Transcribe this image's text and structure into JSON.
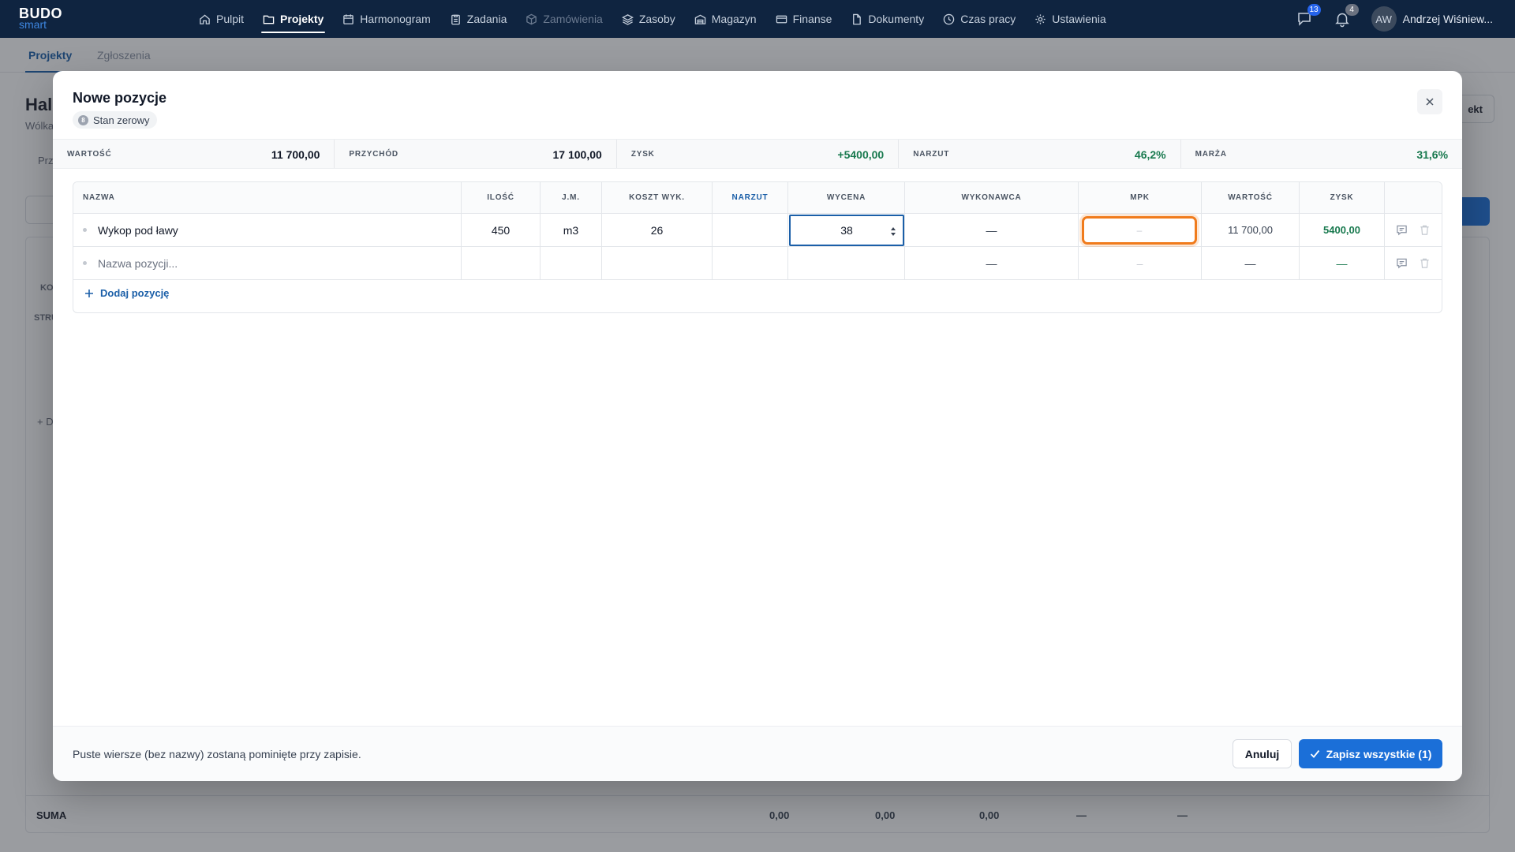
{
  "app": {
    "logo_top": "BUDO",
    "logo_bottom": "smart"
  },
  "nav": {
    "items": [
      {
        "label": "Pulpit",
        "icon": "home-icon"
      },
      {
        "label": "Projekty",
        "icon": "folder-icon"
      },
      {
        "label": "Harmonogram",
        "icon": "calendar-icon"
      },
      {
        "label": "Zadania",
        "icon": "clipboard-icon"
      },
      {
        "label": "Zamówienia",
        "icon": "box-icon"
      },
      {
        "label": "Zasoby",
        "icon": "layers-icon"
      },
      {
        "label": "Magazyn",
        "icon": "warehouse-icon"
      },
      {
        "label": "Finanse",
        "icon": "card-icon"
      },
      {
        "label": "Dokumenty",
        "icon": "document-icon"
      },
      {
        "label": "Czas pracy",
        "icon": "clock-icon"
      },
      {
        "label": "Ustawienia",
        "icon": "gear-icon"
      }
    ],
    "messages_count": "13",
    "notifications_count": "4",
    "user_initials": "AW",
    "user_name": "Andrzej Wiśniew..."
  },
  "page": {
    "subtabs": [
      "Projekty",
      "Zgłoszenia"
    ],
    "title": "Hal",
    "subtitle": "Wólka",
    "tab": "Prz",
    "button_partial": "ekt",
    "table_header_1": "KO",
    "table_header_2": "STRU",
    "add_partial": "+ D",
    "sum_label": "SUMA",
    "sum_values": [
      "0,00",
      "0,00",
      "0,00",
      "—",
      "—"
    ]
  },
  "modal": {
    "title": "Nowe pozycje",
    "badge_number": "8",
    "badge_label": "Stan zerowy",
    "stats": [
      {
        "label": "WARTOŚĆ",
        "value": "11 700,00"
      },
      {
        "label": "PRZYCHÓD",
        "value": "17 100,00"
      },
      {
        "label": "ZYSK",
        "value": "+5400,00"
      },
      {
        "label": "NARZUT",
        "value": "46,2%"
      },
      {
        "label": "MARŻA",
        "value": "31,6%"
      }
    ],
    "columns": [
      "NAZWA",
      "ILOŚĆ",
      "J.M.",
      "KOSZT WYK.",
      "NARZUT",
      "WYCENA",
      "WYKONAWCA",
      "MPK",
      "WARTOŚĆ",
      "ZYSK"
    ],
    "rows": [
      {
        "name": "Wykop pod ławy",
        "qty": "450",
        "unit": "m3",
        "cost": "26",
        "markup": "",
        "price": "38",
        "contractor": "—",
        "mpk": "–",
        "value": "11 700,00",
        "profit": "5400,00"
      },
      {
        "name_placeholder": "Nazwa pozycji...",
        "contractor": "—",
        "mpk": "–",
        "value": "—",
        "profit": "—"
      }
    ],
    "add_position": "Dodaj pozycję",
    "footer_note": "Puste wiersze (bez nazwy) zostaną pominięte przy zapisie.",
    "cancel_label": "Anuluj",
    "save_label": "Zapisz wszystkie (1)"
  },
  "colors": {
    "topbar": "#0f2440",
    "accent": "#1b6fd8",
    "focus_orange": "#f07b1c",
    "positive": "#18794e",
    "badge_blue": "#2563eb",
    "badge_gray": "#6b7280"
  }
}
